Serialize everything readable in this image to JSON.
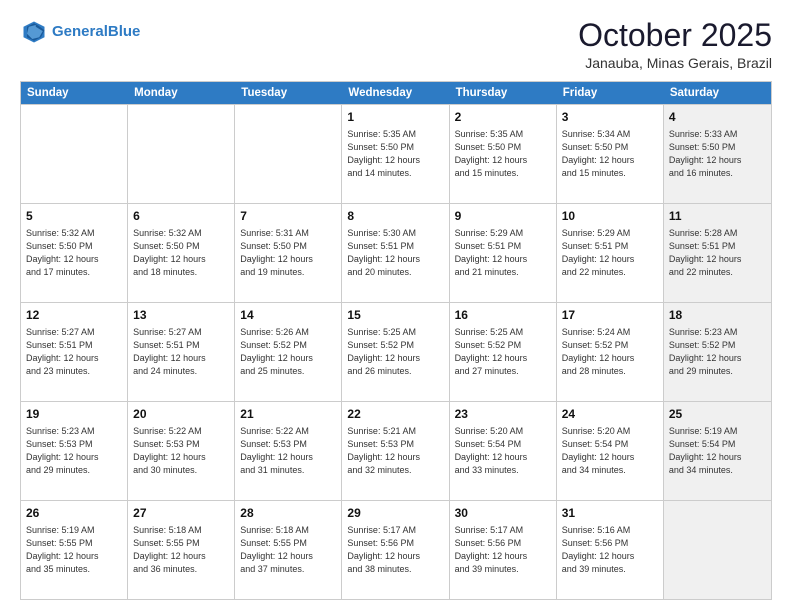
{
  "header": {
    "logo_line1": "General",
    "logo_line2": "Blue",
    "month_title": "October 2025",
    "location": "Janauba, Minas Gerais, Brazil"
  },
  "weekdays": [
    "Sunday",
    "Monday",
    "Tuesday",
    "Wednesday",
    "Thursday",
    "Friday",
    "Saturday"
  ],
  "rows": [
    [
      {
        "day": "",
        "info": "",
        "shaded": false
      },
      {
        "day": "",
        "info": "",
        "shaded": false
      },
      {
        "day": "",
        "info": "",
        "shaded": false
      },
      {
        "day": "1",
        "info": "Sunrise: 5:35 AM\nSunset: 5:50 PM\nDaylight: 12 hours\nand 14 minutes.",
        "shaded": false
      },
      {
        "day": "2",
        "info": "Sunrise: 5:35 AM\nSunset: 5:50 PM\nDaylight: 12 hours\nand 15 minutes.",
        "shaded": false
      },
      {
        "day": "3",
        "info": "Sunrise: 5:34 AM\nSunset: 5:50 PM\nDaylight: 12 hours\nand 15 minutes.",
        "shaded": false
      },
      {
        "day": "4",
        "info": "Sunrise: 5:33 AM\nSunset: 5:50 PM\nDaylight: 12 hours\nand 16 minutes.",
        "shaded": true
      }
    ],
    [
      {
        "day": "5",
        "info": "Sunrise: 5:32 AM\nSunset: 5:50 PM\nDaylight: 12 hours\nand 17 minutes.",
        "shaded": false
      },
      {
        "day": "6",
        "info": "Sunrise: 5:32 AM\nSunset: 5:50 PM\nDaylight: 12 hours\nand 18 minutes.",
        "shaded": false
      },
      {
        "day": "7",
        "info": "Sunrise: 5:31 AM\nSunset: 5:50 PM\nDaylight: 12 hours\nand 19 minutes.",
        "shaded": false
      },
      {
        "day": "8",
        "info": "Sunrise: 5:30 AM\nSunset: 5:51 PM\nDaylight: 12 hours\nand 20 minutes.",
        "shaded": false
      },
      {
        "day": "9",
        "info": "Sunrise: 5:29 AM\nSunset: 5:51 PM\nDaylight: 12 hours\nand 21 minutes.",
        "shaded": false
      },
      {
        "day": "10",
        "info": "Sunrise: 5:29 AM\nSunset: 5:51 PM\nDaylight: 12 hours\nand 22 minutes.",
        "shaded": false
      },
      {
        "day": "11",
        "info": "Sunrise: 5:28 AM\nSunset: 5:51 PM\nDaylight: 12 hours\nand 22 minutes.",
        "shaded": true
      }
    ],
    [
      {
        "day": "12",
        "info": "Sunrise: 5:27 AM\nSunset: 5:51 PM\nDaylight: 12 hours\nand 23 minutes.",
        "shaded": false
      },
      {
        "day": "13",
        "info": "Sunrise: 5:27 AM\nSunset: 5:51 PM\nDaylight: 12 hours\nand 24 minutes.",
        "shaded": false
      },
      {
        "day": "14",
        "info": "Sunrise: 5:26 AM\nSunset: 5:52 PM\nDaylight: 12 hours\nand 25 minutes.",
        "shaded": false
      },
      {
        "day": "15",
        "info": "Sunrise: 5:25 AM\nSunset: 5:52 PM\nDaylight: 12 hours\nand 26 minutes.",
        "shaded": false
      },
      {
        "day": "16",
        "info": "Sunrise: 5:25 AM\nSunset: 5:52 PM\nDaylight: 12 hours\nand 27 minutes.",
        "shaded": false
      },
      {
        "day": "17",
        "info": "Sunrise: 5:24 AM\nSunset: 5:52 PM\nDaylight: 12 hours\nand 28 minutes.",
        "shaded": false
      },
      {
        "day": "18",
        "info": "Sunrise: 5:23 AM\nSunset: 5:52 PM\nDaylight: 12 hours\nand 29 minutes.",
        "shaded": true
      }
    ],
    [
      {
        "day": "19",
        "info": "Sunrise: 5:23 AM\nSunset: 5:53 PM\nDaylight: 12 hours\nand 29 minutes.",
        "shaded": false
      },
      {
        "day": "20",
        "info": "Sunrise: 5:22 AM\nSunset: 5:53 PM\nDaylight: 12 hours\nand 30 minutes.",
        "shaded": false
      },
      {
        "day": "21",
        "info": "Sunrise: 5:22 AM\nSunset: 5:53 PM\nDaylight: 12 hours\nand 31 minutes.",
        "shaded": false
      },
      {
        "day": "22",
        "info": "Sunrise: 5:21 AM\nSunset: 5:53 PM\nDaylight: 12 hours\nand 32 minutes.",
        "shaded": false
      },
      {
        "day": "23",
        "info": "Sunrise: 5:20 AM\nSunset: 5:54 PM\nDaylight: 12 hours\nand 33 minutes.",
        "shaded": false
      },
      {
        "day": "24",
        "info": "Sunrise: 5:20 AM\nSunset: 5:54 PM\nDaylight: 12 hours\nand 34 minutes.",
        "shaded": false
      },
      {
        "day": "25",
        "info": "Sunrise: 5:19 AM\nSunset: 5:54 PM\nDaylight: 12 hours\nand 34 minutes.",
        "shaded": true
      }
    ],
    [
      {
        "day": "26",
        "info": "Sunrise: 5:19 AM\nSunset: 5:55 PM\nDaylight: 12 hours\nand 35 minutes.",
        "shaded": false
      },
      {
        "day": "27",
        "info": "Sunrise: 5:18 AM\nSunset: 5:55 PM\nDaylight: 12 hours\nand 36 minutes.",
        "shaded": false
      },
      {
        "day": "28",
        "info": "Sunrise: 5:18 AM\nSunset: 5:55 PM\nDaylight: 12 hours\nand 37 minutes.",
        "shaded": false
      },
      {
        "day": "29",
        "info": "Sunrise: 5:17 AM\nSunset: 5:56 PM\nDaylight: 12 hours\nand 38 minutes.",
        "shaded": false
      },
      {
        "day": "30",
        "info": "Sunrise: 5:17 AM\nSunset: 5:56 PM\nDaylight: 12 hours\nand 39 minutes.",
        "shaded": false
      },
      {
        "day": "31",
        "info": "Sunrise: 5:16 AM\nSunset: 5:56 PM\nDaylight: 12 hours\nand 39 minutes.",
        "shaded": false
      },
      {
        "day": "",
        "info": "",
        "shaded": true
      }
    ]
  ]
}
